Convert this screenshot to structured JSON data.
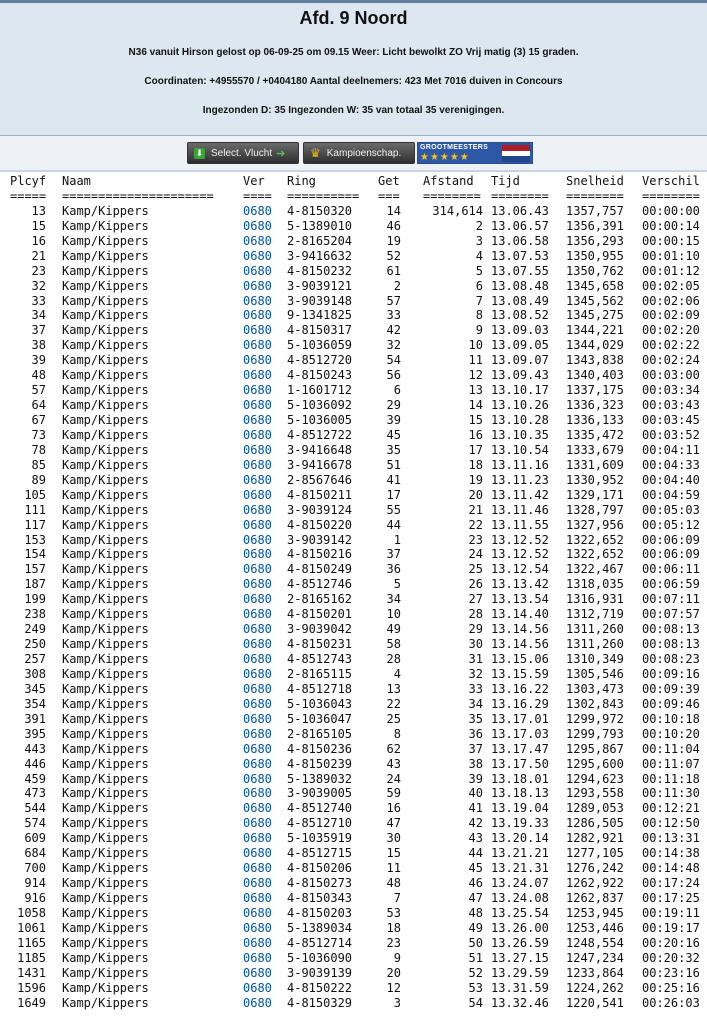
{
  "header": {
    "title": "Afd. 9 Noord",
    "line1": "N36 vanuit Hirson gelost op 06-09-25 om 09.15 Weer: Licht bewolkt ZO Vrij matig (3) 15 graden.",
    "line2": "Coordinaten: +4955570 / +0404180 Aantal deelnemers: 423 Met 7016 duiven in Concours",
    "line3": "Ingezonden D: 35 Ingezonden W: 35 van totaal 35 verenigingen."
  },
  "buttons": {
    "select_vlucht": "Select. Vlucht",
    "kampioenschap": "Kampioenschap.",
    "grootmeesters": "GROOTMEESTERS",
    "grootmeesters_stars": "★★★★★"
  },
  "colors": {
    "header_bg": "#dde7f1",
    "ver_link": "#0055aa",
    "flag": [
      "#ae1c28",
      "#ffffff",
      "#21468b"
    ]
  },
  "table": {
    "headers": [
      "Plcyf",
      "Naam",
      "Ver",
      "Ring",
      "Get",
      "Afstand",
      "Tijd",
      "Snelheid",
      "Verschil"
    ],
    "underlines": [
      "=====",
      "=====================",
      "====",
      "==========",
      "===",
      "========",
      "========",
      "========",
      "========"
    ],
    "rows": [
      [
        "13",
        "Kamp/Kippers",
        "0680",
        "4-8150320",
        "14",
        "314,614",
        "13.06.43",
        "1357,757",
        "00:00:00"
      ],
      [
        "15",
        "Kamp/Kippers",
        "0680",
        "5-1389010",
        "46",
        "2",
        "13.06.57",
        "1356,391",
        "00:00:14"
      ],
      [
        "16",
        "Kamp/Kippers",
        "0680",
        "2-8165204",
        "19",
        "3",
        "13.06.58",
        "1356,293",
        "00:00:15"
      ],
      [
        "21",
        "Kamp/Kippers",
        "0680",
        "3-9416632",
        "52",
        "4",
        "13.07.53",
        "1350,955",
        "00:01:10"
      ],
      [
        "23",
        "Kamp/Kippers",
        "0680",
        "4-8150232",
        "61",
        "5",
        "13.07.55",
        "1350,762",
        "00:01:12"
      ],
      [
        "32",
        "Kamp/Kippers",
        "0680",
        "3-9039121",
        "2",
        "6",
        "13.08.48",
        "1345,658",
        "00:02:05"
      ],
      [
        "33",
        "Kamp/Kippers",
        "0680",
        "3-9039148",
        "57",
        "7",
        "13.08.49",
        "1345,562",
        "00:02:06"
      ],
      [
        "34",
        "Kamp/Kippers",
        "0680",
        "9-1341825",
        "33",
        "8",
        "13.08.52",
        "1345,275",
        "00:02:09"
      ],
      [
        "37",
        "Kamp/Kippers",
        "0680",
        "4-8150317",
        "42",
        "9",
        "13.09.03",
        "1344,221",
        "00:02:20"
      ],
      [
        "38",
        "Kamp/Kippers",
        "0680",
        "5-1036059",
        "32",
        "10",
        "13.09.05",
        "1344,029",
        "00:02:22"
      ],
      [
        "39",
        "Kamp/Kippers",
        "0680",
        "4-8512720",
        "54",
        "11",
        "13.09.07",
        "1343,838",
        "00:02:24"
      ],
      [
        "48",
        "Kamp/Kippers",
        "0680",
        "4-8150243",
        "56",
        "12",
        "13.09.43",
        "1340,403",
        "00:03:00"
      ],
      [
        "57",
        "Kamp/Kippers",
        "0680",
        "1-1601712",
        "6",
        "13",
        "13.10.17",
        "1337,175",
        "00:03:34"
      ],
      [
        "64",
        "Kamp/Kippers",
        "0680",
        "5-1036092",
        "29",
        "14",
        "13.10.26",
        "1336,323",
        "00:03:43"
      ],
      [
        "67",
        "Kamp/Kippers",
        "0680",
        "5-1036005",
        "39",
        "15",
        "13.10.28",
        "1336,133",
        "00:03:45"
      ],
      [
        "73",
        "Kamp/Kippers",
        "0680",
        "4-8512722",
        "45",
        "16",
        "13.10.35",
        "1335,472",
        "00:03:52"
      ],
      [
        "78",
        "Kamp/Kippers",
        "0680",
        "3-9416648",
        "35",
        "17",
        "13.10.54",
        "1333,679",
        "00:04:11"
      ],
      [
        "85",
        "Kamp/Kippers",
        "0680",
        "3-9416678",
        "51",
        "18",
        "13.11.16",
        "1331,609",
        "00:04:33"
      ],
      [
        "89",
        "Kamp/Kippers",
        "0680",
        "2-8567646",
        "41",
        "19",
        "13.11.23",
        "1330,952",
        "00:04:40"
      ],
      [
        "105",
        "Kamp/Kippers",
        "0680",
        "4-8150211",
        "17",
        "20",
        "13.11.42",
        "1329,171",
        "00:04:59"
      ],
      [
        "111",
        "Kamp/Kippers",
        "0680",
        "3-9039124",
        "55",
        "21",
        "13.11.46",
        "1328,797",
        "00:05:03"
      ],
      [
        "117",
        "Kamp/Kippers",
        "0680",
        "4-8150220",
        "44",
        "22",
        "13.11.55",
        "1327,956",
        "00:05:12"
      ],
      [
        "153",
        "Kamp/Kippers",
        "0680",
        "3-9039142",
        "1",
        "23",
        "13.12.52",
        "1322,652",
        "00:06:09"
      ],
      [
        "154",
        "Kamp/Kippers",
        "0680",
        "4-8150216",
        "37",
        "24",
        "13.12.52",
        "1322,652",
        "00:06:09"
      ],
      [
        "157",
        "Kamp/Kippers",
        "0680",
        "4-8150249",
        "36",
        "25",
        "13.12.54",
        "1322,467",
        "00:06:11"
      ],
      [
        "187",
        "Kamp/Kippers",
        "0680",
        "4-8512746",
        "5",
        "26",
        "13.13.42",
        "1318,035",
        "00:06:59"
      ],
      [
        "199",
        "Kamp/Kippers",
        "0680",
        "2-8165162",
        "34",
        "27",
        "13.13.54",
        "1316,931",
        "00:07:11"
      ],
      [
        "238",
        "Kamp/Kippers",
        "0680",
        "4-8150201",
        "10",
        "28",
        "13.14.40",
        "1312,719",
        "00:07:57"
      ],
      [
        "249",
        "Kamp/Kippers",
        "0680",
        "3-9039042",
        "49",
        "29",
        "13.14.56",
        "1311,260",
        "00:08:13"
      ],
      [
        "250",
        "Kamp/Kippers",
        "0680",
        "4-8150231",
        "58",
        "30",
        "13.14.56",
        "1311,260",
        "00:08:13"
      ],
      [
        "257",
        "Kamp/Kippers",
        "0680",
        "4-8512743",
        "28",
        "31",
        "13.15.06",
        "1310,349",
        "00:08:23"
      ],
      [
        "308",
        "Kamp/Kippers",
        "0680",
        "2-8165115",
        "4",
        "32",
        "13.15.59",
        "1305,546",
        "00:09:16"
      ],
      [
        "345",
        "Kamp/Kippers",
        "0680",
        "4-8512718",
        "13",
        "33",
        "13.16.22",
        "1303,473",
        "00:09:39"
      ],
      [
        "354",
        "Kamp/Kippers",
        "0680",
        "5-1036043",
        "22",
        "34",
        "13.16.29",
        "1302,843",
        "00:09:46"
      ],
      [
        "391",
        "Kamp/Kippers",
        "0680",
        "5-1036047",
        "25",
        "35",
        "13.17.01",
        "1299,972",
        "00:10:18"
      ],
      [
        "395",
        "Kamp/Kippers",
        "0680",
        "2-8165105",
        "8",
        "36",
        "13.17.03",
        "1299,793",
        "00:10:20"
      ],
      [
        "443",
        "Kamp/Kippers",
        "0680",
        "4-8150236",
        "62",
        "37",
        "13.17.47",
        "1295,867",
        "00:11:04"
      ],
      [
        "446",
        "Kamp/Kippers",
        "0680",
        "4-8150239",
        "43",
        "38",
        "13.17.50",
        "1295,600",
        "00:11:07"
      ],
      [
        "459",
        "Kamp/Kippers",
        "0680",
        "5-1389032",
        "24",
        "39",
        "13.18.01",
        "1294,623",
        "00:11:18"
      ],
      [
        "473",
        "Kamp/Kippers",
        "0680",
        "3-9039005",
        "59",
        "40",
        "13.18.13",
        "1293,558",
        "00:11:30"
      ],
      [
        "544",
        "Kamp/Kippers",
        "0680",
        "4-8512740",
        "16",
        "41",
        "13.19.04",
        "1289,053",
        "00:12:21"
      ],
      [
        "574",
        "Kamp/Kippers",
        "0680",
        "4-8512710",
        "47",
        "42",
        "13.19.33",
        "1286,505",
        "00:12:50"
      ],
      [
        "609",
        "Kamp/Kippers",
        "0680",
        "5-1035919",
        "30",
        "43",
        "13.20.14",
        "1282,921",
        "00:13:31"
      ],
      [
        "684",
        "Kamp/Kippers",
        "0680",
        "4-8512715",
        "15",
        "44",
        "13.21.21",
        "1277,105",
        "00:14:38"
      ],
      [
        "700",
        "Kamp/Kippers",
        "0680",
        "4-8150206",
        "11",
        "45",
        "13.21.31",
        "1276,242",
        "00:14:48"
      ],
      [
        "914",
        "Kamp/Kippers",
        "0680",
        "4-8150273",
        "48",
        "46",
        "13.24.07",
        "1262,922",
        "00:17:24"
      ],
      [
        "916",
        "Kamp/Kippers",
        "0680",
        "4-8150343",
        "7",
        "47",
        "13.24.08",
        "1262,837",
        "00:17:25"
      ],
      [
        "1058",
        "Kamp/Kippers",
        "0680",
        "4-8150203",
        "53",
        "48",
        "13.25.54",
        "1253,945",
        "00:19:11"
      ],
      [
        "1061",
        "Kamp/Kippers",
        "0680",
        "5-1389034",
        "18",
        "49",
        "13.26.00",
        "1253,446",
        "00:19:17"
      ],
      [
        "1165",
        "Kamp/Kippers",
        "0680",
        "4-8512714",
        "23",
        "50",
        "13.26.59",
        "1248,554",
        "00:20:16"
      ],
      [
        "1185",
        "Kamp/Kippers",
        "0680",
        "5-1036090",
        "9",
        "51",
        "13.27.15",
        "1247,234",
        "00:20:32"
      ],
      [
        "1431",
        "Kamp/Kippers",
        "0680",
        "3-9039139",
        "20",
        "52",
        "13.29.59",
        "1233,864",
        "00:23:16"
      ],
      [
        "1596",
        "Kamp/Kippers",
        "0680",
        "4-8150222",
        "12",
        "53",
        "13.31.59",
        "1224,262",
        "00:25:16"
      ],
      [
        "1649",
        "Kamp/Kippers",
        "0680",
        "4-8150329",
        "3",
        "54",
        "13.32.46",
        "1220,541",
        "00:26:03"
      ]
    ]
  }
}
